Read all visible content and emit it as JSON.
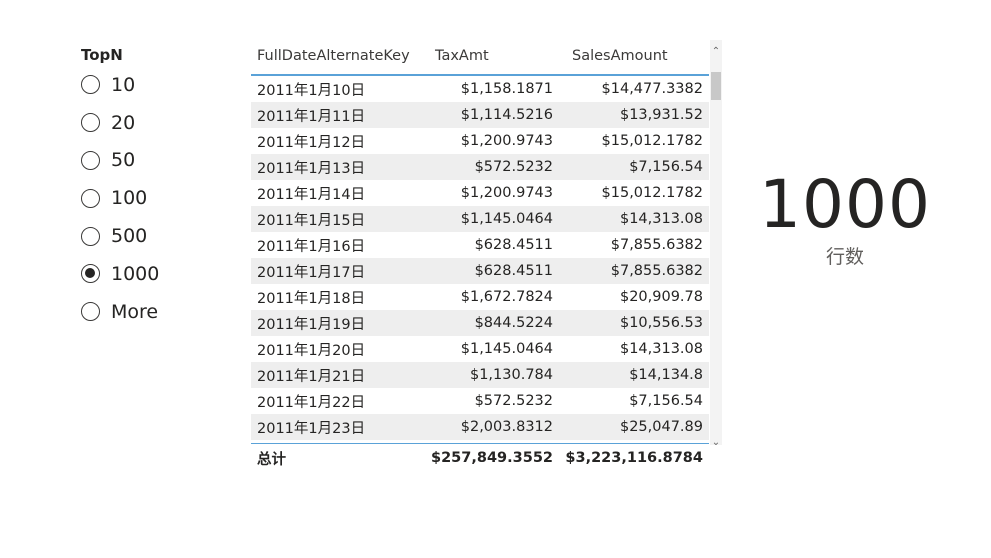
{
  "slicer": {
    "title": "TopN",
    "options": [
      {
        "label": "10",
        "selected": false
      },
      {
        "label": "20",
        "selected": false
      },
      {
        "label": "50",
        "selected": false
      },
      {
        "label": "100",
        "selected": false
      },
      {
        "label": "500",
        "selected": false
      },
      {
        "label": "1000",
        "selected": true
      },
      {
        "label": "More",
        "selected": false
      }
    ]
  },
  "table": {
    "columns": [
      "FullDateAlternateKey",
      "TaxAmt",
      "SalesAmount"
    ],
    "rows": [
      [
        "2011年1月10日",
        "$1,158.1871",
        "$14,477.3382"
      ],
      [
        "2011年1月11日",
        "$1,114.5216",
        "$13,931.52"
      ],
      [
        "2011年1月12日",
        "$1,200.9743",
        "$15,012.1782"
      ],
      [
        "2011年1月13日",
        "$572.5232",
        "$7,156.54"
      ],
      [
        "2011年1月14日",
        "$1,200.9743",
        "$15,012.1782"
      ],
      [
        "2011年1月15日",
        "$1,145.0464",
        "$14,313.08"
      ],
      [
        "2011年1月16日",
        "$628.4511",
        "$7,855.6382"
      ],
      [
        "2011年1月17日",
        "$628.4511",
        "$7,855.6382"
      ],
      [
        "2011年1月18日",
        "$1,672.7824",
        "$20,909.78"
      ],
      [
        "2011年1月19日",
        "$844.5224",
        "$10,556.53"
      ],
      [
        "2011年1月20日",
        "$1,145.0464",
        "$14,313.08"
      ],
      [
        "2011年1月21日",
        "$1,130.784",
        "$14,134.8"
      ],
      [
        "2011年1月22日",
        "$572.5232",
        "$7,156.54"
      ],
      [
        "2011年1月23日",
        "$2,003.8312",
        "$25,047.89"
      ]
    ],
    "total": {
      "label": "总计",
      "tax": "$257,849.3552",
      "sales": "$3,223,116.8784"
    },
    "scroll_up_icon": "chevron-up",
    "scroll_down_icon": "chevron-down"
  },
  "card": {
    "value": "1000",
    "label": "行数"
  }
}
